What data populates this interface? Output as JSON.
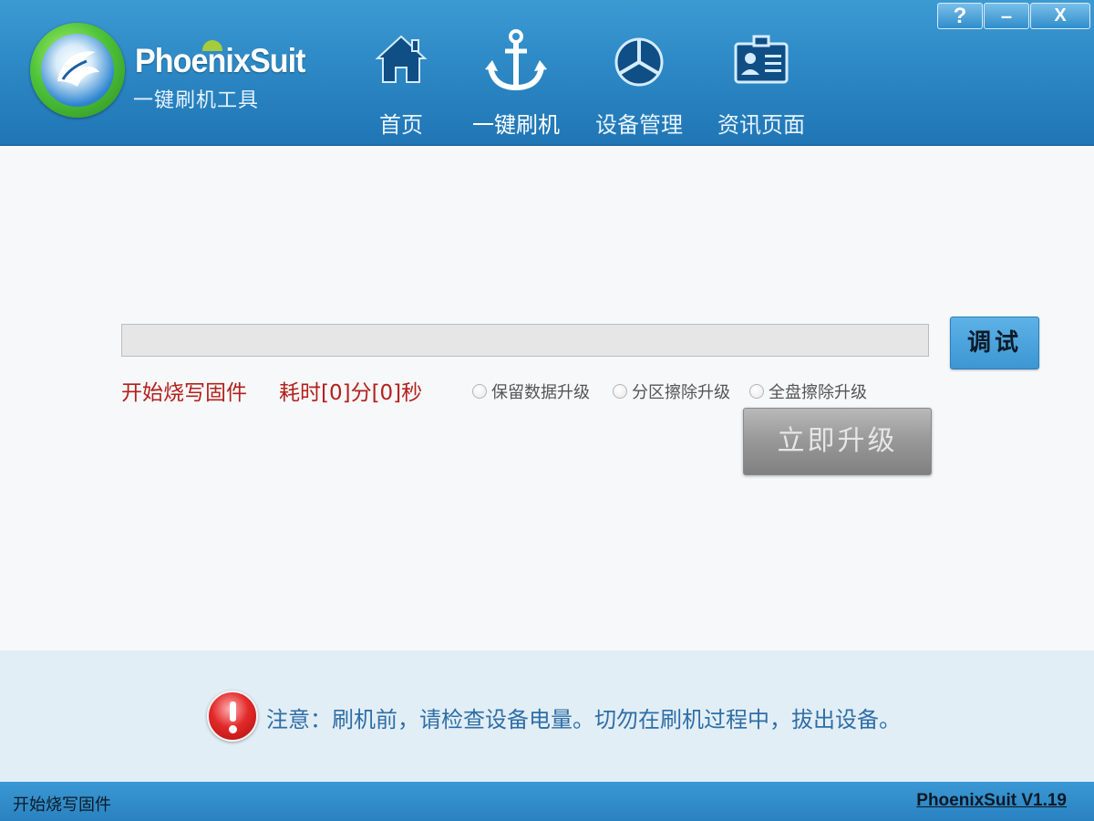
{
  "app": {
    "title": "PhoenixSuit",
    "subtitle": "一键刷机工具"
  },
  "window_controls": {
    "help": "?",
    "minimize": "–",
    "close": "X"
  },
  "nav": {
    "items": [
      {
        "label": "首页",
        "icon": "home-icon"
      },
      {
        "label": "一键刷机",
        "icon": "anchor-icon"
      },
      {
        "label": "设备管理",
        "icon": "device-icon"
      },
      {
        "label": "资讯页面",
        "icon": "news-id-card-icon"
      }
    ],
    "active_index": 1
  },
  "flash": {
    "progress_fraction": 0,
    "debug_label": "调试",
    "status_text": "开始烧写固件",
    "elapsed_text": "耗时[0]分[0]秒",
    "options": [
      "保留数据升级",
      "分区擦除升级",
      "全盘擦除升级"
    ],
    "upgrade_label": "立即升级"
  },
  "notice": {
    "text": "注意：刷机前，请检查设备电量。切勿在刷机过程中，拔出设备。"
  },
  "statusbar": {
    "left_text": "开始烧写固件",
    "version": "PhoenixSuit V1.19"
  },
  "colors": {
    "header_blue": "#2a85c2",
    "status_red": "#b2211c",
    "notice_blue": "#2e6ea6",
    "notice_bg": "#e2eef6"
  }
}
